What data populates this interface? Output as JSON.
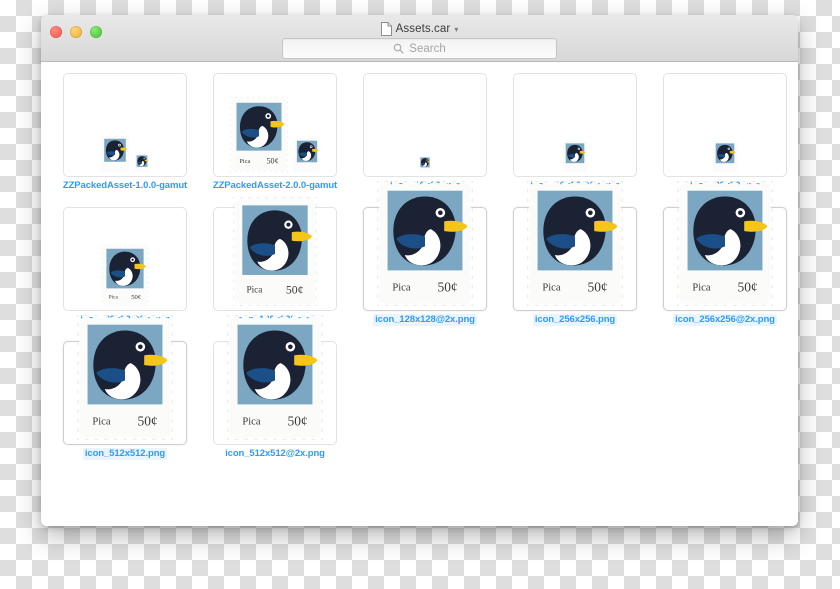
{
  "window": {
    "title": "Assets.car",
    "title_icon": "document-icon",
    "chevron": "chevron-down-icon",
    "traffic_lights": [
      {
        "name": "close-button",
        "color": "#ef5349"
      },
      {
        "name": "minimize-button",
        "color": "#e9ae33"
      },
      {
        "name": "maximize-button",
        "color": "#41c02c"
      }
    ]
  },
  "search": {
    "placeholder": "Search",
    "value": "",
    "icon": "search-icon"
  },
  "stamp": {
    "denomination": "50¢",
    "country": "Pica",
    "colors": {
      "paper": "#fbfbf9",
      "field": "#7ba7c3",
      "body": "#1b2234",
      "belly": "#ffffff",
      "beak": "#f5c518",
      "wing": "#1b4f87",
      "eye_ring": "#ffffff",
      "text": "#3a3a3a"
    }
  },
  "accent_color": "#2f9bf8",
  "files": [
    {
      "name": "ZZPackedAsset-1.0.0-gamut",
      "label": "ZZPackedAsset-1.0.0-gamut",
      "selected": false,
      "stamps": [
        28,
        14
      ]
    },
    {
      "name": "ZZPackedAsset-2.0.0-gamut",
      "label": "ZZPackedAsset-2.0.0-gamut",
      "selected": false,
      "stamps": [
        58,
        26
      ]
    },
    {
      "name": "icon_16x16.png",
      "label": "icon_16x16.png",
      "selected": false,
      "stamps": [
        12
      ]
    },
    {
      "name": "icon_16x16@2x.png",
      "label": "icon_16x16@2x.png",
      "selected": false,
      "stamps": [
        24
      ]
    },
    {
      "name": "icon_32x32.png",
      "label": "icon_32x32.png",
      "selected": false,
      "stamps": [
        24
      ]
    },
    {
      "name": "icon_32x32@2x.png",
      "label": "icon_32x32@2x.png",
      "selected": false,
      "stamps": [
        48
      ]
    },
    {
      "name": "icon_128x128.png",
      "label": "icon_128x128.png",
      "selected": false,
      "stamps": [
        84
      ]
    },
    {
      "name": "icon_128x128@2x.png",
      "label": "icon_128x128@2x.png",
      "selected": true,
      "stamps": [
        96
      ]
    },
    {
      "name": "icon_256x256.png",
      "label": "icon_256x256.png",
      "selected": true,
      "stamps": [
        96
      ]
    },
    {
      "name": "icon_256x256@2x.png",
      "label": "icon_256x256@2x.png",
      "selected": true,
      "stamps": [
        96
      ]
    },
    {
      "name": "icon_512x512.png",
      "label": "icon_512x512.png",
      "selected": true,
      "stamps": [
        96
      ]
    },
    {
      "name": "icon_512x512@2x.png",
      "label": "icon_512x512@2x.png",
      "selected": false,
      "stamps": [
        96
      ]
    }
  ]
}
